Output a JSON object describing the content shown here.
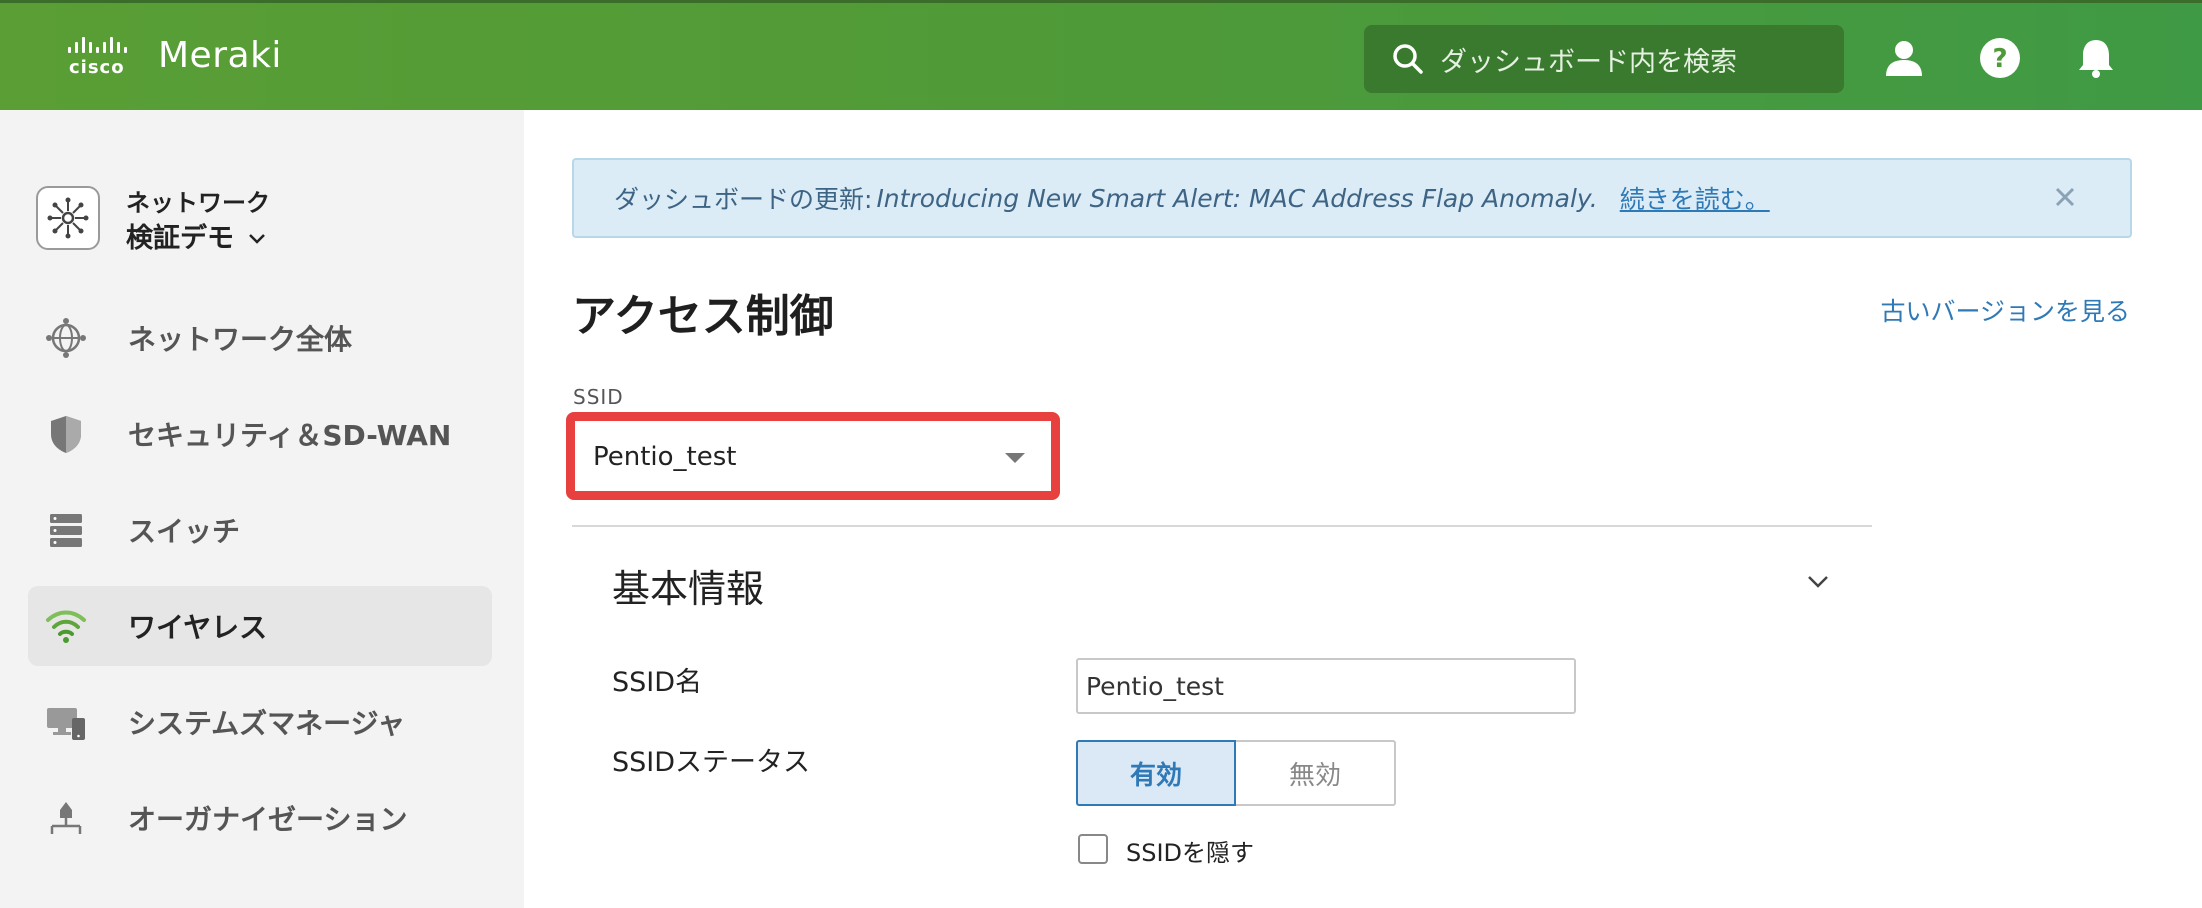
{
  "header": {
    "brand_cisco": "cisco",
    "brand_product": "Meraki",
    "search_placeholder": "ダッシュボード内を検索",
    "icons": [
      "search-icon",
      "user-icon",
      "help-icon",
      "bell-icon"
    ]
  },
  "sidebar": {
    "network_label": "ネットワーク",
    "network_name": "検証デモ",
    "items": [
      {
        "label": "ネットワーク全体",
        "icon": "globe-icon",
        "active": false
      },
      {
        "label": "セキュリティ＆SD-WAN",
        "icon": "shield-icon",
        "active": false
      },
      {
        "label": "スイッチ",
        "icon": "switch-icon",
        "active": false
      },
      {
        "label": "ワイヤレス",
        "icon": "wifi-icon",
        "active": true
      },
      {
        "label": "システムズマネージャ",
        "icon": "devices-icon",
        "active": false
      },
      {
        "label": "オーガナイゼーション",
        "icon": "org-icon",
        "active": false
      }
    ]
  },
  "banner": {
    "prefix": "ダッシュボードの更新:",
    "message": "Introducing New Smart Alert: MAC Address Flap Anomaly.",
    "link": "続きを読む。"
  },
  "main": {
    "title": "アクセス制御",
    "old_version_link": "古いバージョンを見る",
    "ssid_label": "SSID",
    "ssid_selected": "Pentio_test",
    "section_title": "基本情報",
    "ssid_name_label": "SSID名",
    "ssid_name_value": "Pentio_test",
    "ssid_status_label": "SSIDステータス",
    "status_on": "有効",
    "status_off": "無効",
    "hide_ssid_label": "SSIDを隠す"
  },
  "colors": {
    "header_green": "#4f9a38",
    "accent_blue": "#2f79b7",
    "highlight_red": "#e8403f",
    "banner_bg": "#dcecf6"
  }
}
